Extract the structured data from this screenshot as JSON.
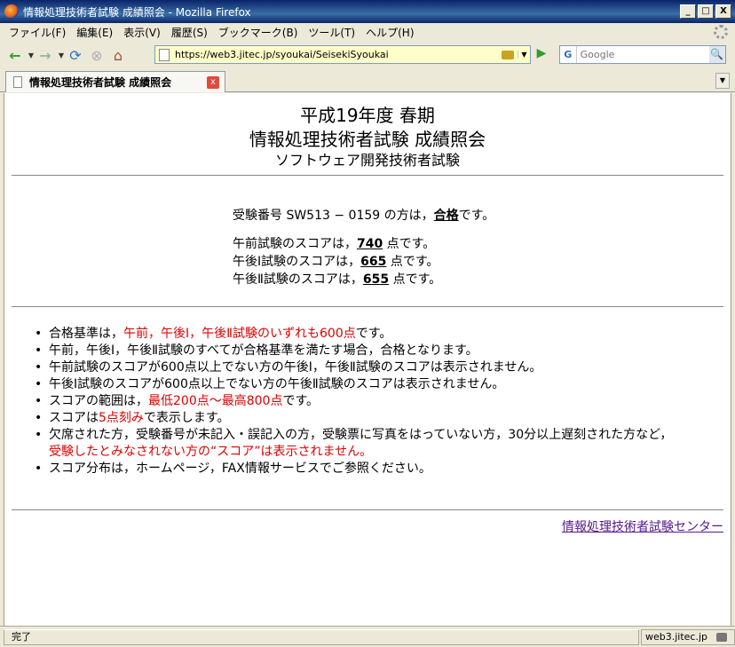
{
  "window": {
    "title": "情報処理技術者試験 成績照会 - Mozilla Firefox",
    "buttons": {
      "minimize": "_",
      "maximize": "□",
      "close": "X"
    }
  },
  "menubar": {
    "items": [
      "ファイル(F)",
      "編集(E)",
      "表示(V)",
      "履歴(S)",
      "ブックマーク(B)",
      "ツール(T)",
      "ヘルプ(H)"
    ]
  },
  "navbar": {
    "url": "https://web3.jitec.jp/syoukai/SeisekiSyoukai",
    "search_engine": "G",
    "search_placeholder": "Google",
    "icons": {
      "back": "←",
      "forward": "→",
      "reload": "⟳",
      "stop": "⊗",
      "home": "⌂",
      "go": "▶",
      "search": "🔍"
    }
  },
  "tab": {
    "label": "情報処理技術者試験 成績照会",
    "close": "x"
  },
  "page": {
    "heading1": "平成19年度 春期",
    "heading2": "情報処理技術者試験 成績照会",
    "heading3": "ソフトウェア開発技術者試験",
    "result": {
      "prefix": "受験番号 SW513 − 0159 の方は，",
      "status": "合格",
      "suffix": "です。"
    },
    "scores": [
      {
        "prefix": "午前試験のスコアは，",
        "value": "740",
        "suffix": " 点です。"
      },
      {
        "prefix": "午後Ⅰ試験のスコアは，",
        "value": "665",
        "suffix": " 点です。"
      },
      {
        "prefix": "午後Ⅱ試験のスコアは，",
        "value": "655",
        "suffix": " 点です。"
      }
    ],
    "notes": {
      "n1_a": "合格基準は，",
      "n1_red": "午前，午後Ⅰ，午後Ⅱ試験のいずれも600点",
      "n1_b": "です。",
      "n2": "午前，午後Ⅰ，午後Ⅱ試験のすべてが合格基準を満たす場合，合格となります。",
      "n3": "午前試験のスコアが600点以上でない方の午後Ⅰ，午後Ⅱ試験のスコアは表示されません。",
      "n4": "午後Ⅰ試験のスコアが600点以上でない方の午後Ⅱ試験のスコアは表示されません。",
      "n5_a": "スコアの範囲は，",
      "n5_red": "最低200点〜最高800点",
      "n5_b": "です。",
      "n6_a": "スコアは",
      "n6_red": "5点刻み",
      "n6_b": "で表示します。",
      "n7_a": "欠席された方，受験番号が未記入・誤記入の方，受験票に写真をはっていない方，30分以上遅刻された方など，",
      "n7_red": "受験したとみなされない方の“スコア”は表示されません。",
      "n8": "スコア分布は，ホームページ，FAX情報サービスでご参照ください。"
    },
    "footer_link": "情報処理技術者試験センター"
  },
  "statusbar": {
    "text": "完了",
    "domain": "web3.jitec.jp"
  }
}
